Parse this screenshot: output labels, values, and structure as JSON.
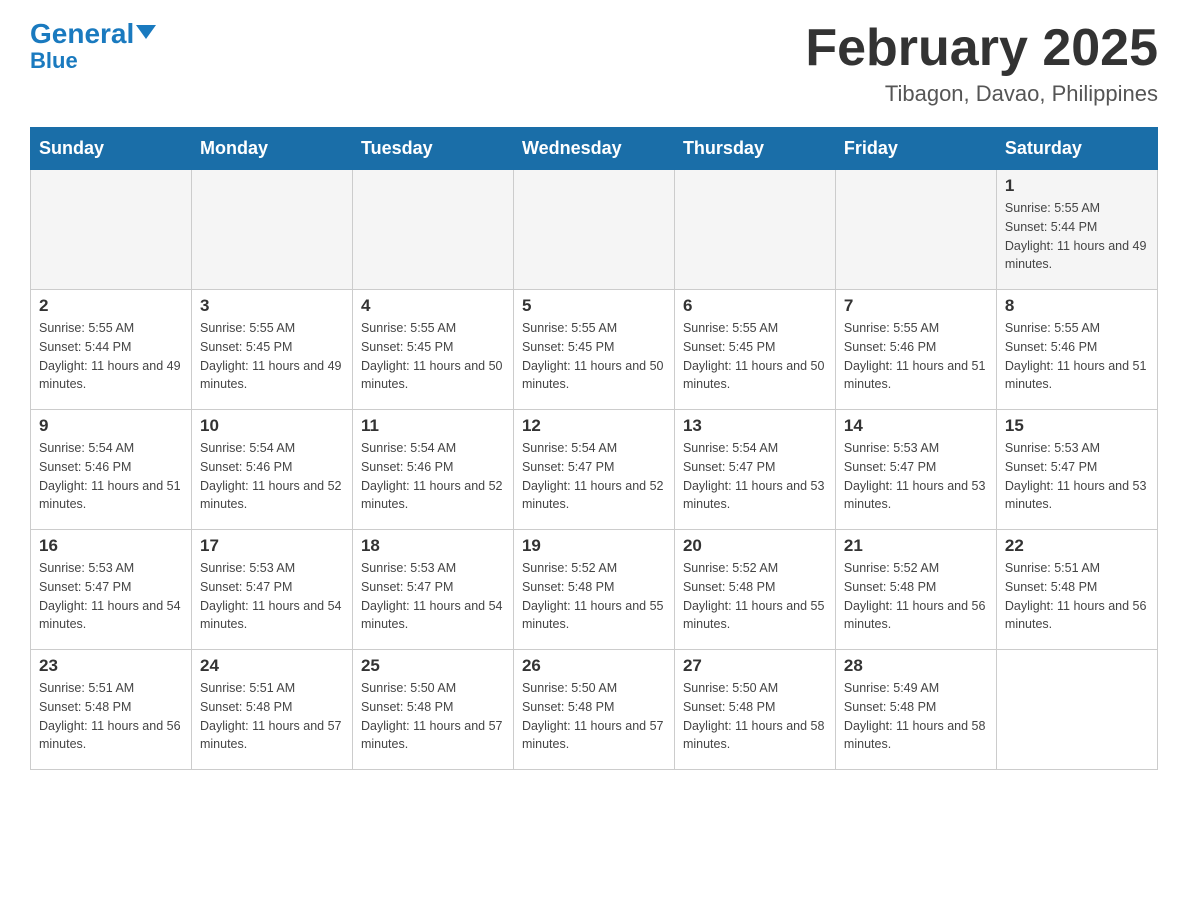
{
  "logo": {
    "general": "General",
    "blue": "Blue"
  },
  "header": {
    "month": "February 2025",
    "location": "Tibagon, Davao, Philippines"
  },
  "days_of_week": [
    "Sunday",
    "Monday",
    "Tuesday",
    "Wednesday",
    "Thursday",
    "Friday",
    "Saturday"
  ],
  "weeks": [
    {
      "days": [
        {
          "number": "",
          "sunrise": "",
          "sunset": "",
          "daylight": ""
        },
        {
          "number": "",
          "sunrise": "",
          "sunset": "",
          "daylight": ""
        },
        {
          "number": "",
          "sunrise": "",
          "sunset": "",
          "daylight": ""
        },
        {
          "number": "",
          "sunrise": "",
          "sunset": "",
          "daylight": ""
        },
        {
          "number": "",
          "sunrise": "",
          "sunset": "",
          "daylight": ""
        },
        {
          "number": "",
          "sunrise": "",
          "sunset": "",
          "daylight": ""
        },
        {
          "number": "1",
          "sunrise": "Sunrise: 5:55 AM",
          "sunset": "Sunset: 5:44 PM",
          "daylight": "Daylight: 11 hours and 49 minutes."
        }
      ]
    },
    {
      "days": [
        {
          "number": "2",
          "sunrise": "Sunrise: 5:55 AM",
          "sunset": "Sunset: 5:44 PM",
          "daylight": "Daylight: 11 hours and 49 minutes."
        },
        {
          "number": "3",
          "sunrise": "Sunrise: 5:55 AM",
          "sunset": "Sunset: 5:45 PM",
          "daylight": "Daylight: 11 hours and 49 minutes."
        },
        {
          "number": "4",
          "sunrise": "Sunrise: 5:55 AM",
          "sunset": "Sunset: 5:45 PM",
          "daylight": "Daylight: 11 hours and 50 minutes."
        },
        {
          "number": "5",
          "sunrise": "Sunrise: 5:55 AM",
          "sunset": "Sunset: 5:45 PM",
          "daylight": "Daylight: 11 hours and 50 minutes."
        },
        {
          "number": "6",
          "sunrise": "Sunrise: 5:55 AM",
          "sunset": "Sunset: 5:45 PM",
          "daylight": "Daylight: 11 hours and 50 minutes."
        },
        {
          "number": "7",
          "sunrise": "Sunrise: 5:55 AM",
          "sunset": "Sunset: 5:46 PM",
          "daylight": "Daylight: 11 hours and 51 minutes."
        },
        {
          "number": "8",
          "sunrise": "Sunrise: 5:55 AM",
          "sunset": "Sunset: 5:46 PM",
          "daylight": "Daylight: 11 hours and 51 minutes."
        }
      ]
    },
    {
      "days": [
        {
          "number": "9",
          "sunrise": "Sunrise: 5:54 AM",
          "sunset": "Sunset: 5:46 PM",
          "daylight": "Daylight: 11 hours and 51 minutes."
        },
        {
          "number": "10",
          "sunrise": "Sunrise: 5:54 AM",
          "sunset": "Sunset: 5:46 PM",
          "daylight": "Daylight: 11 hours and 52 minutes."
        },
        {
          "number": "11",
          "sunrise": "Sunrise: 5:54 AM",
          "sunset": "Sunset: 5:46 PM",
          "daylight": "Daylight: 11 hours and 52 minutes."
        },
        {
          "number": "12",
          "sunrise": "Sunrise: 5:54 AM",
          "sunset": "Sunset: 5:47 PM",
          "daylight": "Daylight: 11 hours and 52 minutes."
        },
        {
          "number": "13",
          "sunrise": "Sunrise: 5:54 AM",
          "sunset": "Sunset: 5:47 PM",
          "daylight": "Daylight: 11 hours and 53 minutes."
        },
        {
          "number": "14",
          "sunrise": "Sunrise: 5:53 AM",
          "sunset": "Sunset: 5:47 PM",
          "daylight": "Daylight: 11 hours and 53 minutes."
        },
        {
          "number": "15",
          "sunrise": "Sunrise: 5:53 AM",
          "sunset": "Sunset: 5:47 PM",
          "daylight": "Daylight: 11 hours and 53 minutes."
        }
      ]
    },
    {
      "days": [
        {
          "number": "16",
          "sunrise": "Sunrise: 5:53 AM",
          "sunset": "Sunset: 5:47 PM",
          "daylight": "Daylight: 11 hours and 54 minutes."
        },
        {
          "number": "17",
          "sunrise": "Sunrise: 5:53 AM",
          "sunset": "Sunset: 5:47 PM",
          "daylight": "Daylight: 11 hours and 54 minutes."
        },
        {
          "number": "18",
          "sunrise": "Sunrise: 5:53 AM",
          "sunset": "Sunset: 5:47 PM",
          "daylight": "Daylight: 11 hours and 54 minutes."
        },
        {
          "number": "19",
          "sunrise": "Sunrise: 5:52 AM",
          "sunset": "Sunset: 5:48 PM",
          "daylight": "Daylight: 11 hours and 55 minutes."
        },
        {
          "number": "20",
          "sunrise": "Sunrise: 5:52 AM",
          "sunset": "Sunset: 5:48 PM",
          "daylight": "Daylight: 11 hours and 55 minutes."
        },
        {
          "number": "21",
          "sunrise": "Sunrise: 5:52 AM",
          "sunset": "Sunset: 5:48 PM",
          "daylight": "Daylight: 11 hours and 56 minutes."
        },
        {
          "number": "22",
          "sunrise": "Sunrise: 5:51 AM",
          "sunset": "Sunset: 5:48 PM",
          "daylight": "Daylight: 11 hours and 56 minutes."
        }
      ]
    },
    {
      "days": [
        {
          "number": "23",
          "sunrise": "Sunrise: 5:51 AM",
          "sunset": "Sunset: 5:48 PM",
          "daylight": "Daylight: 11 hours and 56 minutes."
        },
        {
          "number": "24",
          "sunrise": "Sunrise: 5:51 AM",
          "sunset": "Sunset: 5:48 PM",
          "daylight": "Daylight: 11 hours and 57 minutes."
        },
        {
          "number": "25",
          "sunrise": "Sunrise: 5:50 AM",
          "sunset": "Sunset: 5:48 PM",
          "daylight": "Daylight: 11 hours and 57 minutes."
        },
        {
          "number": "26",
          "sunrise": "Sunrise: 5:50 AM",
          "sunset": "Sunset: 5:48 PM",
          "daylight": "Daylight: 11 hours and 57 minutes."
        },
        {
          "number": "27",
          "sunrise": "Sunrise: 5:50 AM",
          "sunset": "Sunset: 5:48 PM",
          "daylight": "Daylight: 11 hours and 58 minutes."
        },
        {
          "number": "28",
          "sunrise": "Sunrise: 5:49 AM",
          "sunset": "Sunset: 5:48 PM",
          "daylight": "Daylight: 11 hours and 58 minutes."
        },
        {
          "number": "",
          "sunrise": "",
          "sunset": "",
          "daylight": ""
        }
      ]
    }
  ]
}
